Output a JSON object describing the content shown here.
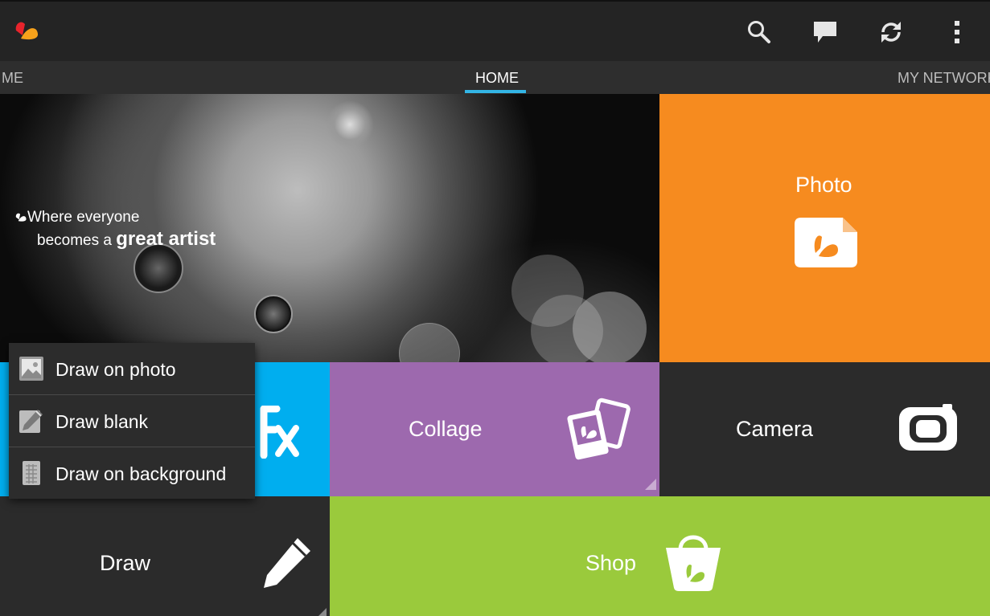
{
  "tabs": [
    {
      "label": "ME"
    },
    {
      "label": "HOME"
    },
    {
      "label": "MY NETWORK"
    }
  ],
  "active_tab": "HOME",
  "hero": {
    "tagline_line1": "Where everyone",
    "tagline_line2_prefix": "becomes a ",
    "tagline_line2_bold": "great artist"
  },
  "tiles": {
    "photo": "Photo",
    "collage": "Collage",
    "camera": "Camera",
    "draw": "Draw",
    "shop": "Shop"
  },
  "draw_menu": [
    {
      "label": "Draw on photo"
    },
    {
      "label": "Draw blank"
    },
    {
      "label": "Draw on background"
    }
  ],
  "icons": {
    "actionbar": [
      "logo-icon",
      "search-icon",
      "chat-icon",
      "sync-icon",
      "overflow-menu-icon"
    ],
    "tiles": [
      "photo-tile-icon",
      "fx-icon",
      "collage-photos-icon",
      "camera-icon",
      "pencil-icon",
      "shopping-bag-icon"
    ],
    "draw_menu": [
      "image-icon",
      "pencil-icon",
      "grid-background-icon"
    ]
  },
  "colors": {
    "accent_tab": "#33b5e5",
    "photo_tile": "#f68b1f",
    "fx_tile": "#00aeef",
    "collage_tile": "#9d69ae",
    "camera_tile": "#2b2b2b",
    "draw_tile": "#2b2b2b",
    "shop_tile": "#9aca3c"
  }
}
